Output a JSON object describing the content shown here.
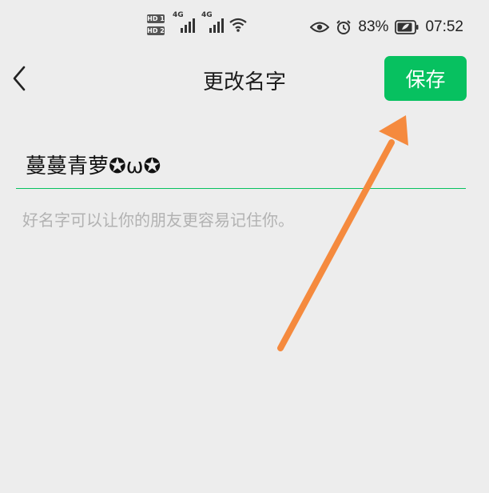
{
  "status_bar": {
    "hd_badge_1": "HD 1",
    "hd_badge_2": "HD 2",
    "network_1": "4G",
    "network_2": "4G",
    "battery_percent": "83%",
    "time": "07:52",
    "icons": [
      "hd-icon",
      "signal-icon",
      "signal-icon",
      "wifi-icon",
      "eye-icon",
      "alarm-icon",
      "battery-icon"
    ]
  },
  "nav": {
    "title": "更改名字",
    "save_label": "保存",
    "back_icon": "chevron-left-icon"
  },
  "form": {
    "name_value": "蔓蔓青萝✪ω✪",
    "hint": "好名字可以让你的朋友更容易记住你。"
  },
  "colors": {
    "accent": "#07c160",
    "background": "#ededed",
    "annotation_arrow": "#f58a3e"
  }
}
